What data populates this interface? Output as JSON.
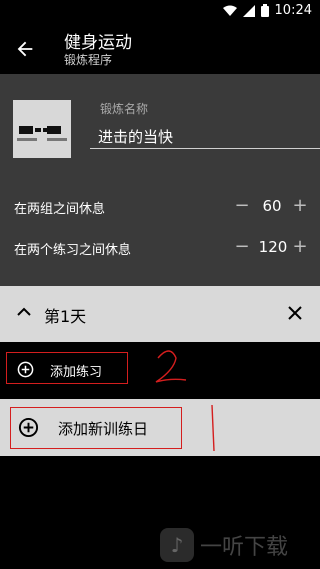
{
  "status": {
    "time": "10:24"
  },
  "appbar": {
    "title": "健身运动",
    "subtitle": "锻炼程序"
  },
  "program": {
    "name_label": "锻炼名称",
    "name_value": "进击的当快"
  },
  "rest_sets": {
    "label": "在两组之间休息",
    "value": "60",
    "minus": "−",
    "plus": "+"
  },
  "rest_exercises": {
    "label": "在两个练习之间休息",
    "value": "120",
    "minus": "−",
    "plus": "+"
  },
  "day": {
    "label": "第1天"
  },
  "add_exercise": {
    "label": "添加练习",
    "annotation": "2"
  },
  "add_day": {
    "label": "添加新训练日",
    "annotation": "1"
  },
  "watermark": {
    "text": "一听下载"
  },
  "colors": {
    "panel": "#3a3a3a",
    "header": "#d9d9d9",
    "annotation": "#d41e1e"
  }
}
